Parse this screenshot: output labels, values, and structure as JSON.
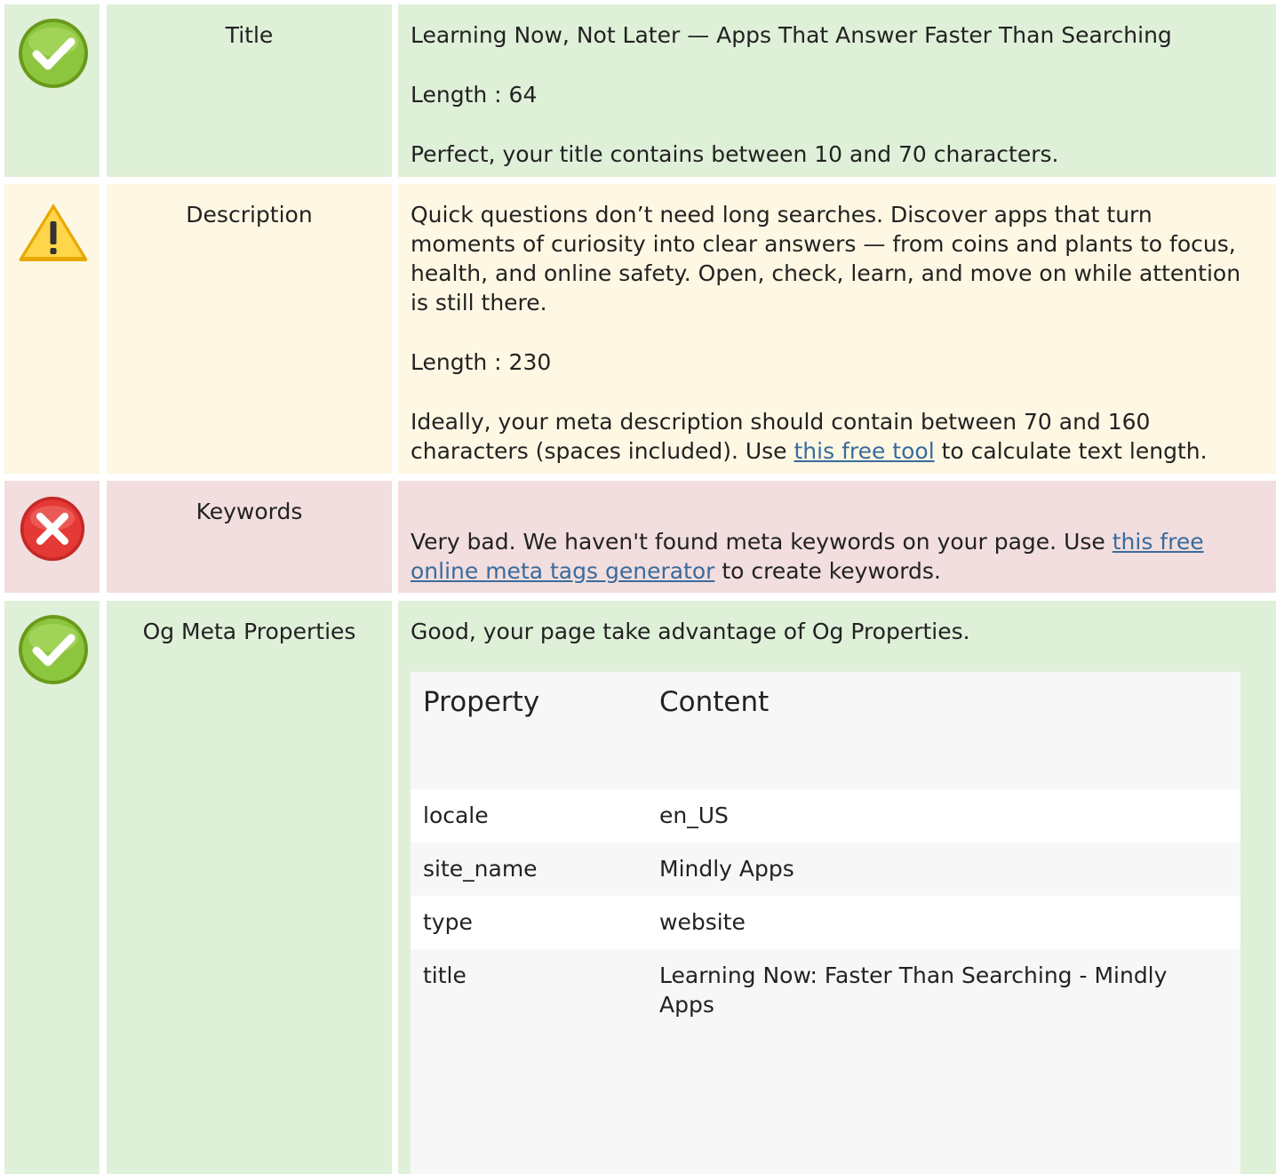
{
  "rows": {
    "title": {
      "status": "good",
      "label": "Title",
      "text": "Learning Now, Not Later — Apps That Answer Faster Than Searching",
      "length": "Length : 64",
      "verdict": "Perfect, your title contains between 10 and 70 characters."
    },
    "description": {
      "status": "warning",
      "label": "Description",
      "text": "Quick questions don’t need long searches. Discover apps that turn moments of curiosity into clear answers — from coins and plants to focus, health, and online safety. Open, check, learn, and move on while attention is still there.",
      "length": "Length : 230",
      "verdict_before": "Ideally, your meta description should contain between 70 and 160 characters (spaces included). Use ",
      "verdict_link": "this free tool",
      "verdict_after": " to calculate text length."
    },
    "keywords": {
      "status": "bad",
      "label": "Keywords",
      "verdict_before": "Very bad. We haven't found meta keywords on your page. Use ",
      "verdict_link": "this free online meta tags generator",
      "verdict_after": " to create keywords."
    },
    "og": {
      "status": "good",
      "label": "Og Meta Properties",
      "verdict": "Good, your page take advantage of Og Properties.",
      "table": {
        "header_property": "Property",
        "header_content": "Content",
        "rows": [
          {
            "property": "locale",
            "content": "en_US"
          },
          {
            "property": "site_name",
            "content": "Mindly Apps"
          },
          {
            "property": "type",
            "content": "website"
          },
          {
            "property": "title",
            "content": "Learning Now: Faster Than Searching - Mindly Apps"
          }
        ]
      }
    }
  },
  "icons": {
    "good": "check-circle-icon",
    "warning": "warning-triangle-icon",
    "bad": "error-x-circle-icon"
  },
  "colors": {
    "good_bg": "#dff0d8",
    "warning_bg": "#fdf7e3",
    "bad_bg": "#f2dede",
    "link": "#3a6b9c"
  }
}
